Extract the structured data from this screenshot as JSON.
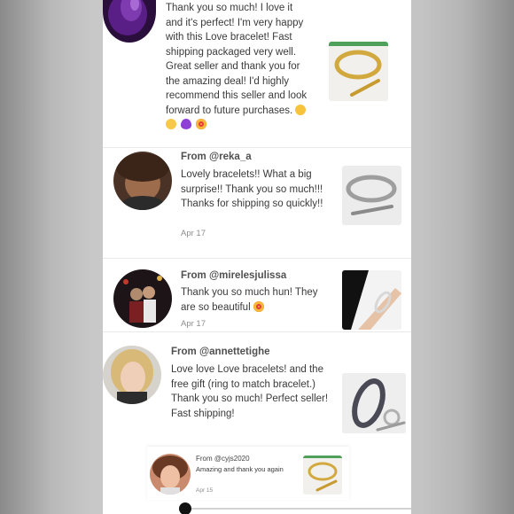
{
  "reviews": [
    {
      "from": "",
      "text": "Thank you so much! I love it and it's perfect! I'm very happy with this Love bracelet! Fast shipping packaged very well. Great seller and thank you for the amazing deal! I'd highly recommend this seller and look forward to future purchases.",
      "emojis": [
        "grinning-star-eyes-emoji",
        "smiling-emoji",
        "purple-heart-emoji",
        "heart-eyes-emoji"
      ],
      "date": "",
      "thumb_icon": "gold-bracelet-icon"
    },
    {
      "from": "From @reka_a",
      "text": "Lovely bracelets!! What a big surprise!! Thank you so much!!! Thanks for shipping so quickly!!",
      "date": "Apr 17",
      "thumb_icon": "silver-bracelet-icon"
    },
    {
      "from": "From @mirelesjulissa",
      "text": "Thank you so much hun! They are so beautiful",
      "emojis": [
        "heart-eyes-emoji"
      ],
      "date": "Apr 17",
      "thumb_icon": "worn-bracelet-icon"
    },
    {
      "from": "From @annettetighe",
      "text": "Love love Love bracelets! and the free gift (ring to match bracelet.) Thank you so much! Perfect seller! Fast shipping!",
      "date": "",
      "thumb_icon": "bracelet-and-ring-icon"
    },
    {
      "from": "From @cyjs2020",
      "text": "Amazing and thank you again",
      "date": "Apr 15",
      "thumb_icon": "gold-bracelet-icon"
    }
  ],
  "colors": {
    "background": "#c4c4c4",
    "card": "#ffffff",
    "username": "#505050",
    "body_text": "#3a3a3a",
    "date": "#8d8d8d",
    "gold": "#c9a23a",
    "silver": "#b5b5b5",
    "scrubber": "#111111"
  }
}
